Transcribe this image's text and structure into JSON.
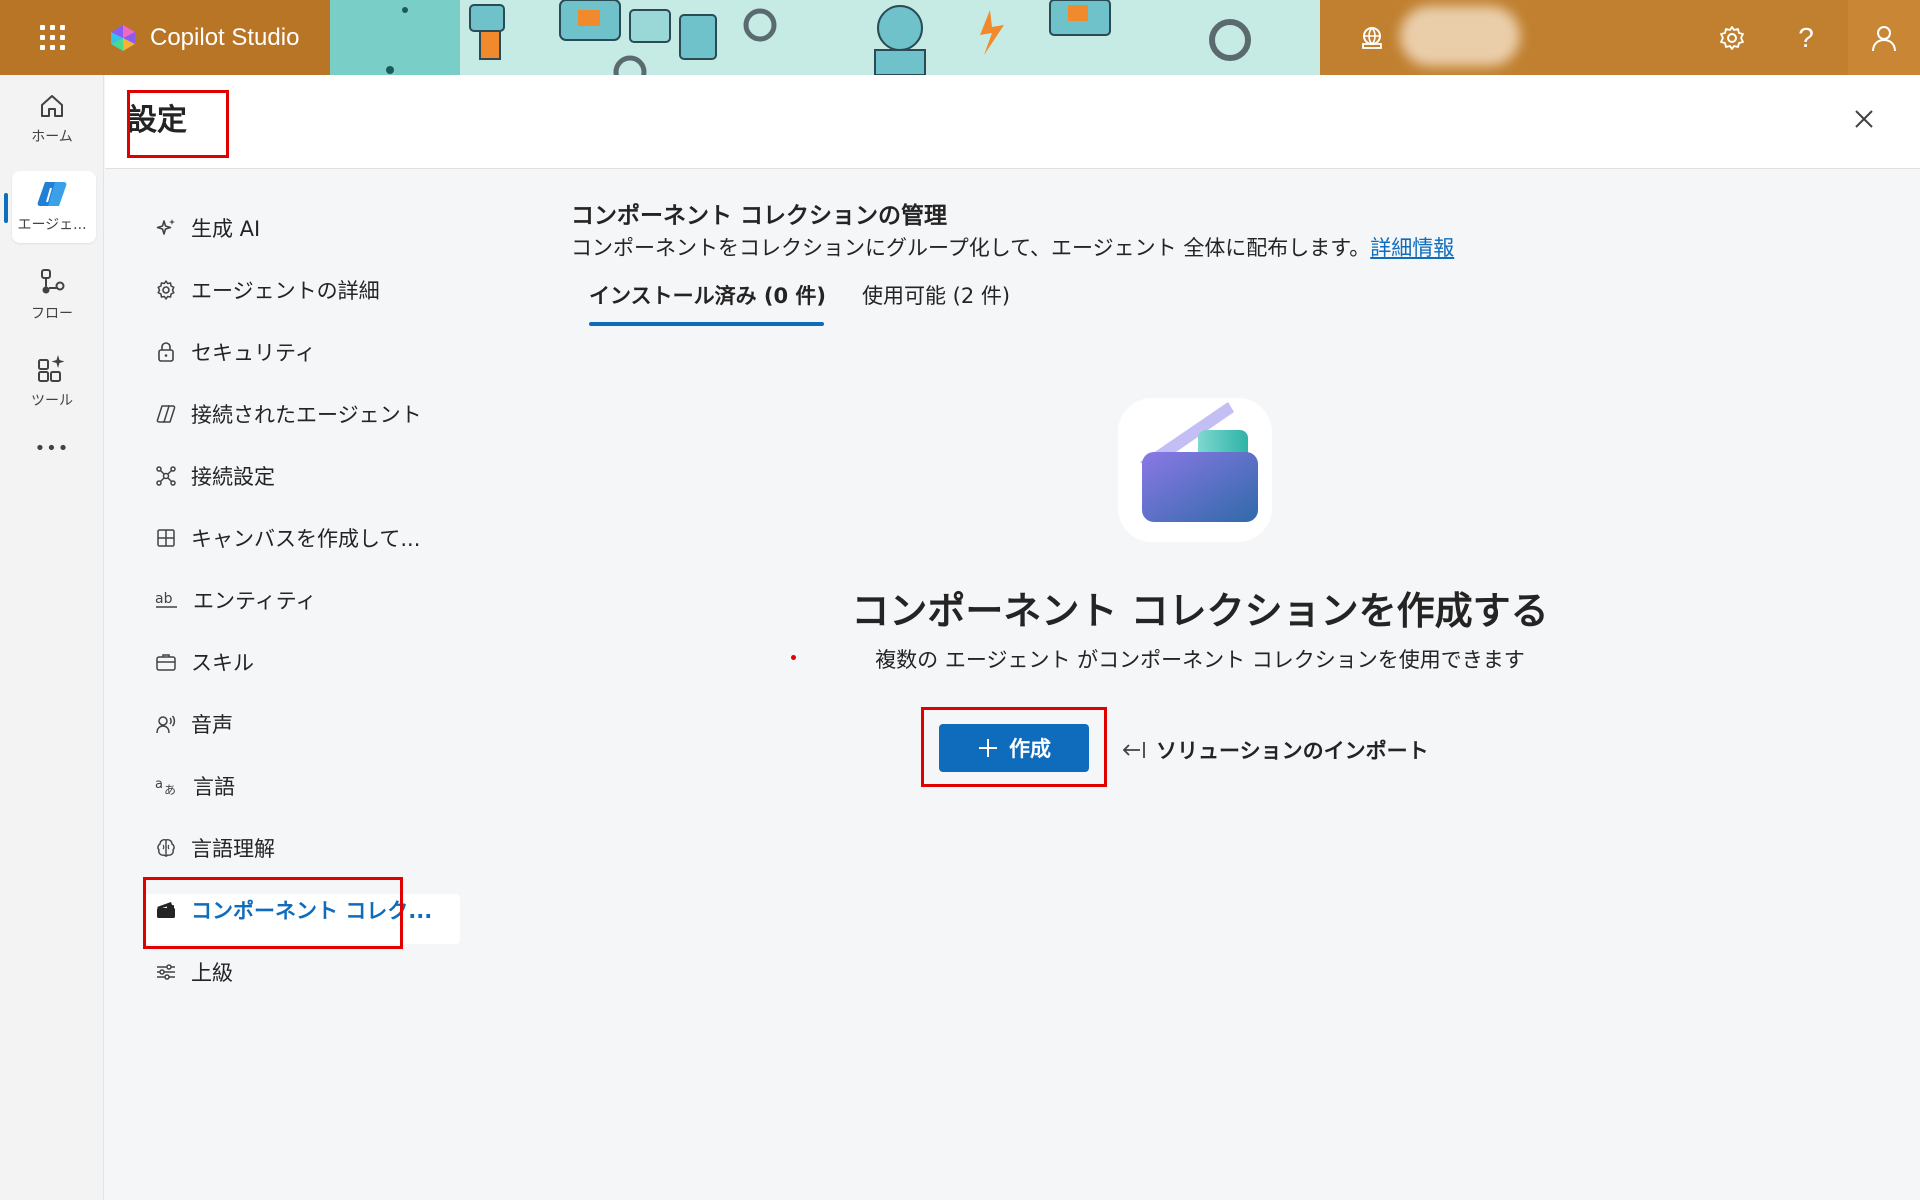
{
  "app": {
    "name": "Copilot Studio"
  },
  "topbar": {
    "icons": [
      "waffle-icon",
      "environment-icon",
      "settings-icon",
      "help-icon",
      "user-icon"
    ],
    "help_glyph": "?"
  },
  "rail": {
    "items": [
      {
        "label": "ホーム",
        "icon": "home-icon"
      },
      {
        "label": "エージェ...",
        "icon": "agent-icon"
      },
      {
        "label": "フロー",
        "icon": "flow-icon"
      },
      {
        "label": "ツール",
        "icon": "tools-icon"
      }
    ],
    "more": "•••"
  },
  "settings": {
    "title": "設定",
    "nav": [
      {
        "label": "生成 AI",
        "icon": "sparkle-icon"
      },
      {
        "label": "エージェントの詳細",
        "icon": "gear-icon"
      },
      {
        "label": "セキュリティ",
        "icon": "lock-icon"
      },
      {
        "label": "接続されたエージェント",
        "icon": "connected-agent-icon"
      },
      {
        "label": "接続設定",
        "icon": "connection-icon"
      },
      {
        "label": "キャンバスを作成して...",
        "icon": "grid-icon"
      },
      {
        "label": "エンティティ",
        "icon": "entity-icon"
      },
      {
        "label": "スキル",
        "icon": "briefcase-icon"
      },
      {
        "label": "音声",
        "icon": "voice-icon"
      },
      {
        "label": "言語",
        "icon": "language-icon"
      },
      {
        "label": "言語理解",
        "icon": "brain-icon"
      },
      {
        "label": "コンポーネント コレク...",
        "icon": "collection-icon"
      },
      {
        "label": "上級",
        "icon": "sliders-icon"
      }
    ],
    "active_index": 11
  },
  "main": {
    "title": "コンポーネント コレクションの管理",
    "description": "コンポーネントをコレクションにグループ化して、エージェント 全体に配布します。",
    "learn_more": "詳細情報",
    "tabs": [
      {
        "label": "インストール済み (0 件)",
        "active": true
      },
      {
        "label": "使用可能 (2 件)",
        "active": false
      }
    ],
    "empty": {
      "title": "コンポーネント コレクションを作成する",
      "subtitle": "複数の エージェント がコンポーネント コレクションを使用できます"
    },
    "create_button": "作成",
    "import_button": "ソリューションのインポート"
  },
  "colors": {
    "topbar": "#b87526",
    "accent": "#0f6cbd",
    "highlight_box": "#e00000"
  }
}
